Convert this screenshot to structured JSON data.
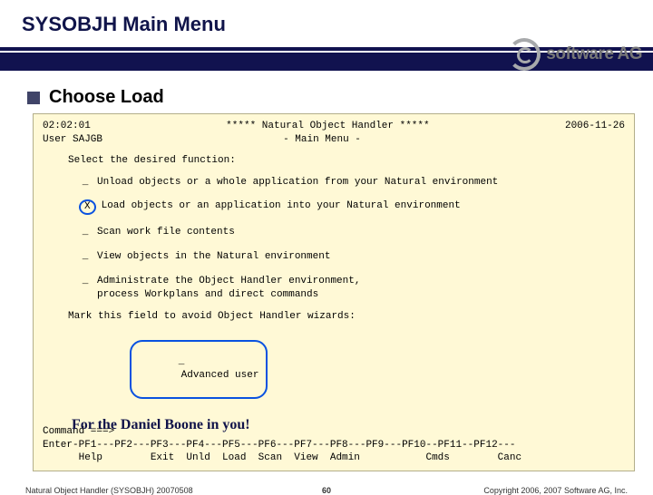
{
  "title": "SYSOBJH Main Menu",
  "logo": "software AG",
  "bullet": "Choose Load",
  "terminal": {
    "time": "02:02:01",
    "header_center": "***** Natural Object Handler *****",
    "date": "2006-11-26",
    "user": "User SAJGB",
    "subtitle": "- Main Menu -",
    "prompt": "Select the desired function:",
    "options": [
      {
        "mark": "_",
        "circled": false,
        "text": "Unload objects or a whole application from your Natural environment"
      },
      {
        "mark": "X",
        "circled": true,
        "text": "Load objects or an application into your Natural environment"
      },
      {
        "mark": "_",
        "circled": false,
        "text": "Scan work file contents"
      },
      {
        "mark": "_",
        "circled": false,
        "text": "View objects in the Natural environment"
      },
      {
        "mark": "_",
        "circled": false,
        "text": "Administrate the Object Handler environment,\nprocess Workplans and direct commands"
      }
    ],
    "avoid": "Mark this field to avoid Object Handler wizards:",
    "adv_mark": "_",
    "adv_label": "Advanced user",
    "cmd": "Command ===>",
    "pf1": "Enter-PF1---PF2---PF3---PF4---PF5---PF6---PF7---PF8---PF9---PF10--PF11--PF12---",
    "pf2": "      Help        Exit  Unld  Load  Scan  View  Admin           Cmds        Canc"
  },
  "slogan": "For the Daniel Boone in you!",
  "footer_left": "Natural Object Handler (SYSOBJH) 20070508",
  "page": "60",
  "footer_right": "Copyright 2006, 2007 Software AG, Inc."
}
